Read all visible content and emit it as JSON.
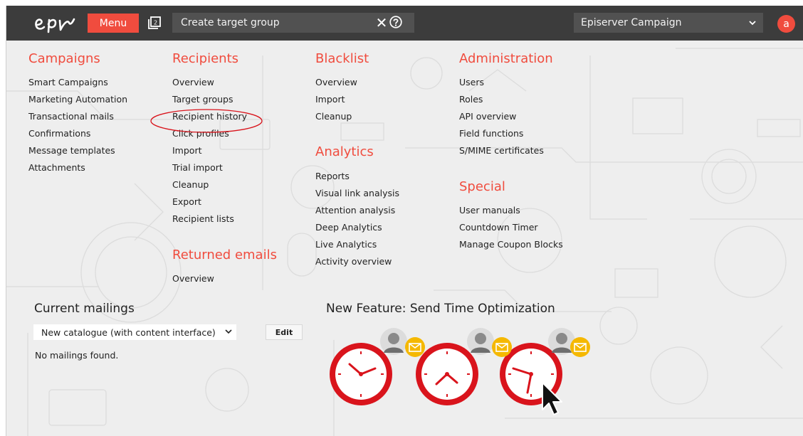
{
  "topbar": {
    "menu_label": "Menu",
    "search_text": "Create target group",
    "clear_symbol": "✕",
    "account_name": "Episerver Campaign",
    "avatar_letter": "a",
    "icons": [
      "episerver-logo",
      "tabs-icon",
      "close-icon",
      "help-icon",
      "chevron-down-icon"
    ]
  },
  "menu": {
    "campaigns": {
      "title": "Campaigns",
      "items": [
        "Smart Campaigns",
        "Marketing Automation",
        "Transactional mails",
        "Confirmations",
        "Message templates",
        "Attachments"
      ]
    },
    "recipients": {
      "title": "Recipients",
      "items": [
        "Overview",
        "Target groups",
        "Recipient history",
        "Click profiles",
        "Import",
        "Trial import",
        "Cleanup",
        "Export",
        "Recipient lists"
      ]
    },
    "returned_emails": {
      "title": "Returned emails",
      "items": [
        "Overview"
      ]
    },
    "blacklist": {
      "title": "Blacklist",
      "items": [
        "Overview",
        "Import",
        "Cleanup"
      ]
    },
    "analytics": {
      "title": "Analytics",
      "items": [
        "Reports",
        "Visual link analysis",
        "Attention analysis",
        "Deep Analytics",
        "Live Analytics",
        "Activity overview"
      ]
    },
    "administration": {
      "title": "Administration",
      "items": [
        "Users",
        "Roles",
        "API overview",
        "Field functions",
        "S/MIME certificates"
      ]
    },
    "special": {
      "title": "Special",
      "items": [
        "User manuals",
        "Countdown Timer",
        "Manage Coupon Blocks"
      ]
    },
    "highlighted_item": "Recipient history"
  },
  "current_mailings": {
    "title": "Current mailings",
    "selected": "New catalogue (with content interface)",
    "edit_label": "Edit",
    "empty_text": "No mailings found."
  },
  "feature": {
    "title": "New Feature: Send Time Optimization"
  },
  "colors": {
    "accent": "#f04c3e",
    "topbar": "#3c3c3c",
    "background": "#eeeeee",
    "mail_badge": "#f5b800",
    "clock_red": "#d9141c"
  }
}
